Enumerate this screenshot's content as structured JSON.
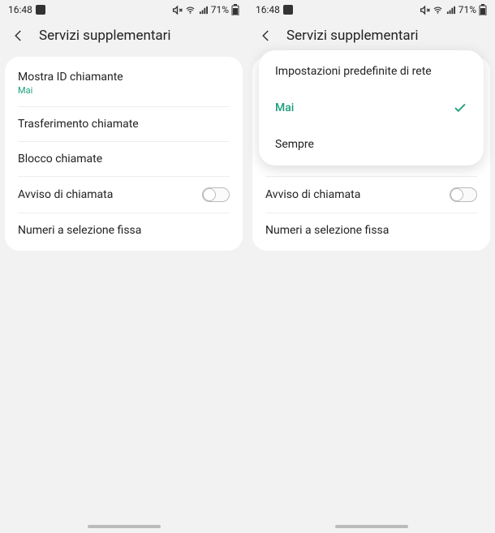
{
  "status": {
    "time": "16:48",
    "battery": "71%"
  },
  "header": {
    "title": "Servizi supplementari"
  },
  "settings": {
    "caller_id": {
      "label": "Mostra ID chiamante",
      "value": "Mai"
    },
    "forwarding": {
      "label": "Trasferimento chiamate"
    },
    "blocking": {
      "label": "Blocco chiamate"
    },
    "waiting": {
      "label": "Avviso di chiamata"
    },
    "fixed": {
      "label": "Numeri a selezione fissa"
    }
  },
  "popup": {
    "option1": "Impostazioni predefinite di rete",
    "option2": "Mai",
    "option3": "Sempre"
  }
}
